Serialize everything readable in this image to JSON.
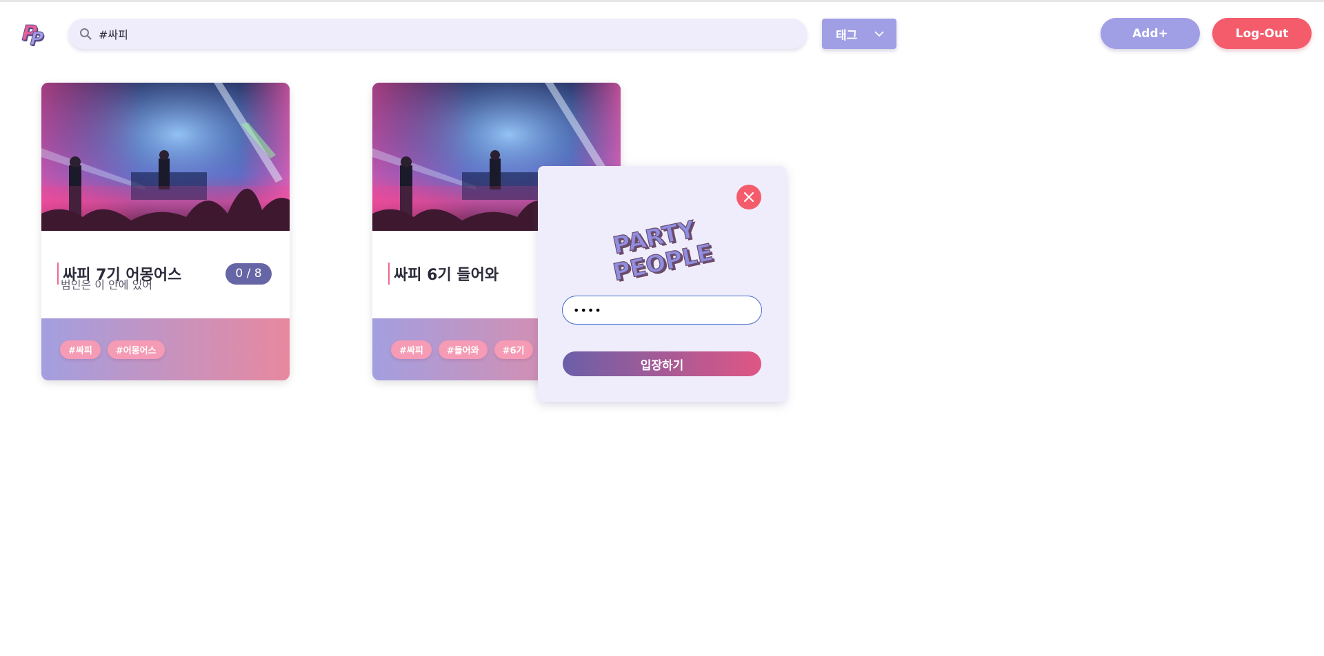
{
  "header": {
    "search": {
      "value": "#싸피",
      "placeholder": ""
    },
    "tag_select": {
      "label": "태그"
    },
    "add_label": "Add+",
    "logout_label": "Log-Out"
  },
  "rooms": [
    {
      "title": "싸피 7기 어몽어스",
      "count": "0 / 8",
      "description": "범인은 이 안에 있어",
      "tags": [
        "#싸피",
        "#어몽어스"
      ]
    },
    {
      "title": "싸피 6기 들어와",
      "count": "",
      "description": "",
      "tags": [
        "#싸피",
        "#들어와",
        "#6기"
      ]
    }
  ],
  "modal": {
    "password_value": "••••",
    "enter_label": "입장하기",
    "logo_text": [
      "PARTY",
      "PEOPLE"
    ]
  },
  "icons": {
    "search": "search-icon",
    "dropdown": "chevron-down-icon",
    "close": "close-icon",
    "logo": "party-people-logo-icon"
  },
  "colors": {
    "accent": "#a09ee4",
    "danger": "#f45c6c",
    "badge": "#6665a5",
    "chip": "#f59bb5",
    "panel": "#efedfb"
  }
}
